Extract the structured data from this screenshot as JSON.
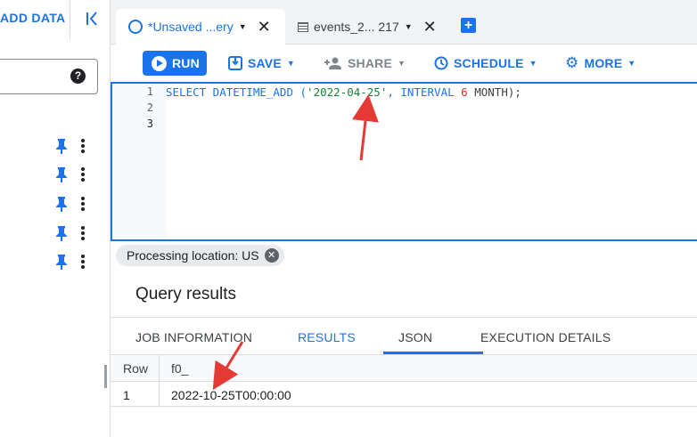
{
  "left_panel": {
    "add_data_label": "ADD DATA",
    "help_glyph": "?"
  },
  "tabs": [
    {
      "label": "*Unsaved ...ery",
      "icon": "query-icon",
      "active": true
    },
    {
      "label": "events_2... 217",
      "icon": "table-icon",
      "active": false
    }
  ],
  "toolbar": {
    "run_label": "RUN",
    "save_label": "SAVE",
    "share_label": "SHARE",
    "schedule_label": "SCHEDULE",
    "more_label": "MORE"
  },
  "editor": {
    "line_numbers": [
      "1",
      "2",
      "3"
    ],
    "sql_kw1": "SELECT DATETIME_ADD (",
    "sql_str": "'2022-04-25'",
    "sql_kw2": ", INTERVAL ",
    "sql_num": "6",
    "sql_kw3": " MONTH);"
  },
  "processing_location": "Processing location: US",
  "results": {
    "title": "Query results",
    "tabs": [
      "JOB INFORMATION",
      "RESULTS",
      "JSON",
      "EXECUTION DETAILS"
    ],
    "active_tab": "RESULTS",
    "columns": [
      "Row",
      "f0_"
    ],
    "rows": [
      [
        "1",
        "2022-10-25T00:00:00"
      ]
    ]
  },
  "colors": {
    "accent": "#1a73e8",
    "arrow": "#e53935",
    "string": "#188038",
    "number": "#d93025"
  }
}
